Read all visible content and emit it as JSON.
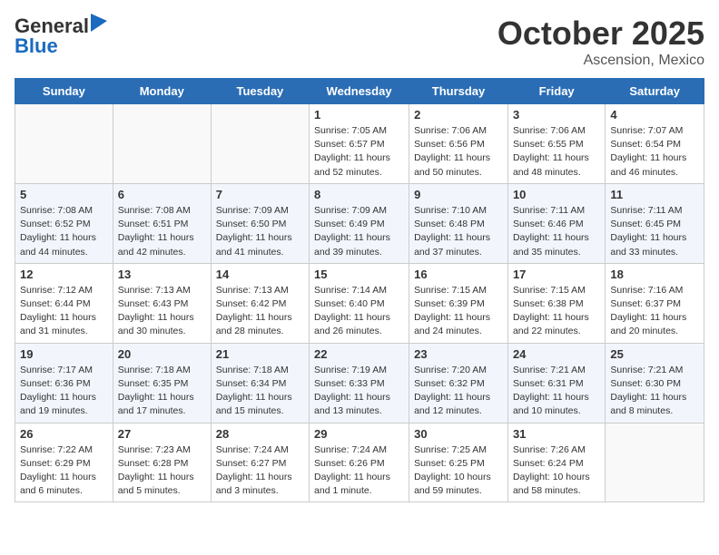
{
  "header": {
    "logo_line1": "General",
    "logo_line2": "Blue",
    "month": "October 2025",
    "location": "Ascension, Mexico"
  },
  "days_of_week": [
    "Sunday",
    "Monday",
    "Tuesday",
    "Wednesday",
    "Thursday",
    "Friday",
    "Saturday"
  ],
  "weeks": [
    [
      {
        "day": "",
        "info": ""
      },
      {
        "day": "",
        "info": ""
      },
      {
        "day": "",
        "info": ""
      },
      {
        "day": "1",
        "info": "Sunrise: 7:05 AM\nSunset: 6:57 PM\nDaylight: 11 hours\nand 52 minutes."
      },
      {
        "day": "2",
        "info": "Sunrise: 7:06 AM\nSunset: 6:56 PM\nDaylight: 11 hours\nand 50 minutes."
      },
      {
        "day": "3",
        "info": "Sunrise: 7:06 AM\nSunset: 6:55 PM\nDaylight: 11 hours\nand 48 minutes."
      },
      {
        "day": "4",
        "info": "Sunrise: 7:07 AM\nSunset: 6:54 PM\nDaylight: 11 hours\nand 46 minutes."
      }
    ],
    [
      {
        "day": "5",
        "info": "Sunrise: 7:08 AM\nSunset: 6:52 PM\nDaylight: 11 hours\nand 44 minutes."
      },
      {
        "day": "6",
        "info": "Sunrise: 7:08 AM\nSunset: 6:51 PM\nDaylight: 11 hours\nand 42 minutes."
      },
      {
        "day": "7",
        "info": "Sunrise: 7:09 AM\nSunset: 6:50 PM\nDaylight: 11 hours\nand 41 minutes."
      },
      {
        "day": "8",
        "info": "Sunrise: 7:09 AM\nSunset: 6:49 PM\nDaylight: 11 hours\nand 39 minutes."
      },
      {
        "day": "9",
        "info": "Sunrise: 7:10 AM\nSunset: 6:48 PM\nDaylight: 11 hours\nand 37 minutes."
      },
      {
        "day": "10",
        "info": "Sunrise: 7:11 AM\nSunset: 6:46 PM\nDaylight: 11 hours\nand 35 minutes."
      },
      {
        "day": "11",
        "info": "Sunrise: 7:11 AM\nSunset: 6:45 PM\nDaylight: 11 hours\nand 33 minutes."
      }
    ],
    [
      {
        "day": "12",
        "info": "Sunrise: 7:12 AM\nSunset: 6:44 PM\nDaylight: 11 hours\nand 31 minutes."
      },
      {
        "day": "13",
        "info": "Sunrise: 7:13 AM\nSunset: 6:43 PM\nDaylight: 11 hours\nand 30 minutes."
      },
      {
        "day": "14",
        "info": "Sunrise: 7:13 AM\nSunset: 6:42 PM\nDaylight: 11 hours\nand 28 minutes."
      },
      {
        "day": "15",
        "info": "Sunrise: 7:14 AM\nSunset: 6:40 PM\nDaylight: 11 hours\nand 26 minutes."
      },
      {
        "day": "16",
        "info": "Sunrise: 7:15 AM\nSunset: 6:39 PM\nDaylight: 11 hours\nand 24 minutes."
      },
      {
        "day": "17",
        "info": "Sunrise: 7:15 AM\nSunset: 6:38 PM\nDaylight: 11 hours\nand 22 minutes."
      },
      {
        "day": "18",
        "info": "Sunrise: 7:16 AM\nSunset: 6:37 PM\nDaylight: 11 hours\nand 20 minutes."
      }
    ],
    [
      {
        "day": "19",
        "info": "Sunrise: 7:17 AM\nSunset: 6:36 PM\nDaylight: 11 hours\nand 19 minutes."
      },
      {
        "day": "20",
        "info": "Sunrise: 7:18 AM\nSunset: 6:35 PM\nDaylight: 11 hours\nand 17 minutes."
      },
      {
        "day": "21",
        "info": "Sunrise: 7:18 AM\nSunset: 6:34 PM\nDaylight: 11 hours\nand 15 minutes."
      },
      {
        "day": "22",
        "info": "Sunrise: 7:19 AM\nSunset: 6:33 PM\nDaylight: 11 hours\nand 13 minutes."
      },
      {
        "day": "23",
        "info": "Sunrise: 7:20 AM\nSunset: 6:32 PM\nDaylight: 11 hours\nand 12 minutes."
      },
      {
        "day": "24",
        "info": "Sunrise: 7:21 AM\nSunset: 6:31 PM\nDaylight: 11 hours\nand 10 minutes."
      },
      {
        "day": "25",
        "info": "Sunrise: 7:21 AM\nSunset: 6:30 PM\nDaylight: 11 hours\nand 8 minutes."
      }
    ],
    [
      {
        "day": "26",
        "info": "Sunrise: 7:22 AM\nSunset: 6:29 PM\nDaylight: 11 hours\nand 6 minutes."
      },
      {
        "day": "27",
        "info": "Sunrise: 7:23 AM\nSunset: 6:28 PM\nDaylight: 11 hours\nand 5 minutes."
      },
      {
        "day": "28",
        "info": "Sunrise: 7:24 AM\nSunset: 6:27 PM\nDaylight: 11 hours\nand 3 minutes."
      },
      {
        "day": "29",
        "info": "Sunrise: 7:24 AM\nSunset: 6:26 PM\nDaylight: 11 hours\nand 1 minute."
      },
      {
        "day": "30",
        "info": "Sunrise: 7:25 AM\nSunset: 6:25 PM\nDaylight: 10 hours\nand 59 minutes."
      },
      {
        "day": "31",
        "info": "Sunrise: 7:26 AM\nSunset: 6:24 PM\nDaylight: 10 hours\nand 58 minutes."
      },
      {
        "day": "",
        "info": ""
      }
    ]
  ]
}
